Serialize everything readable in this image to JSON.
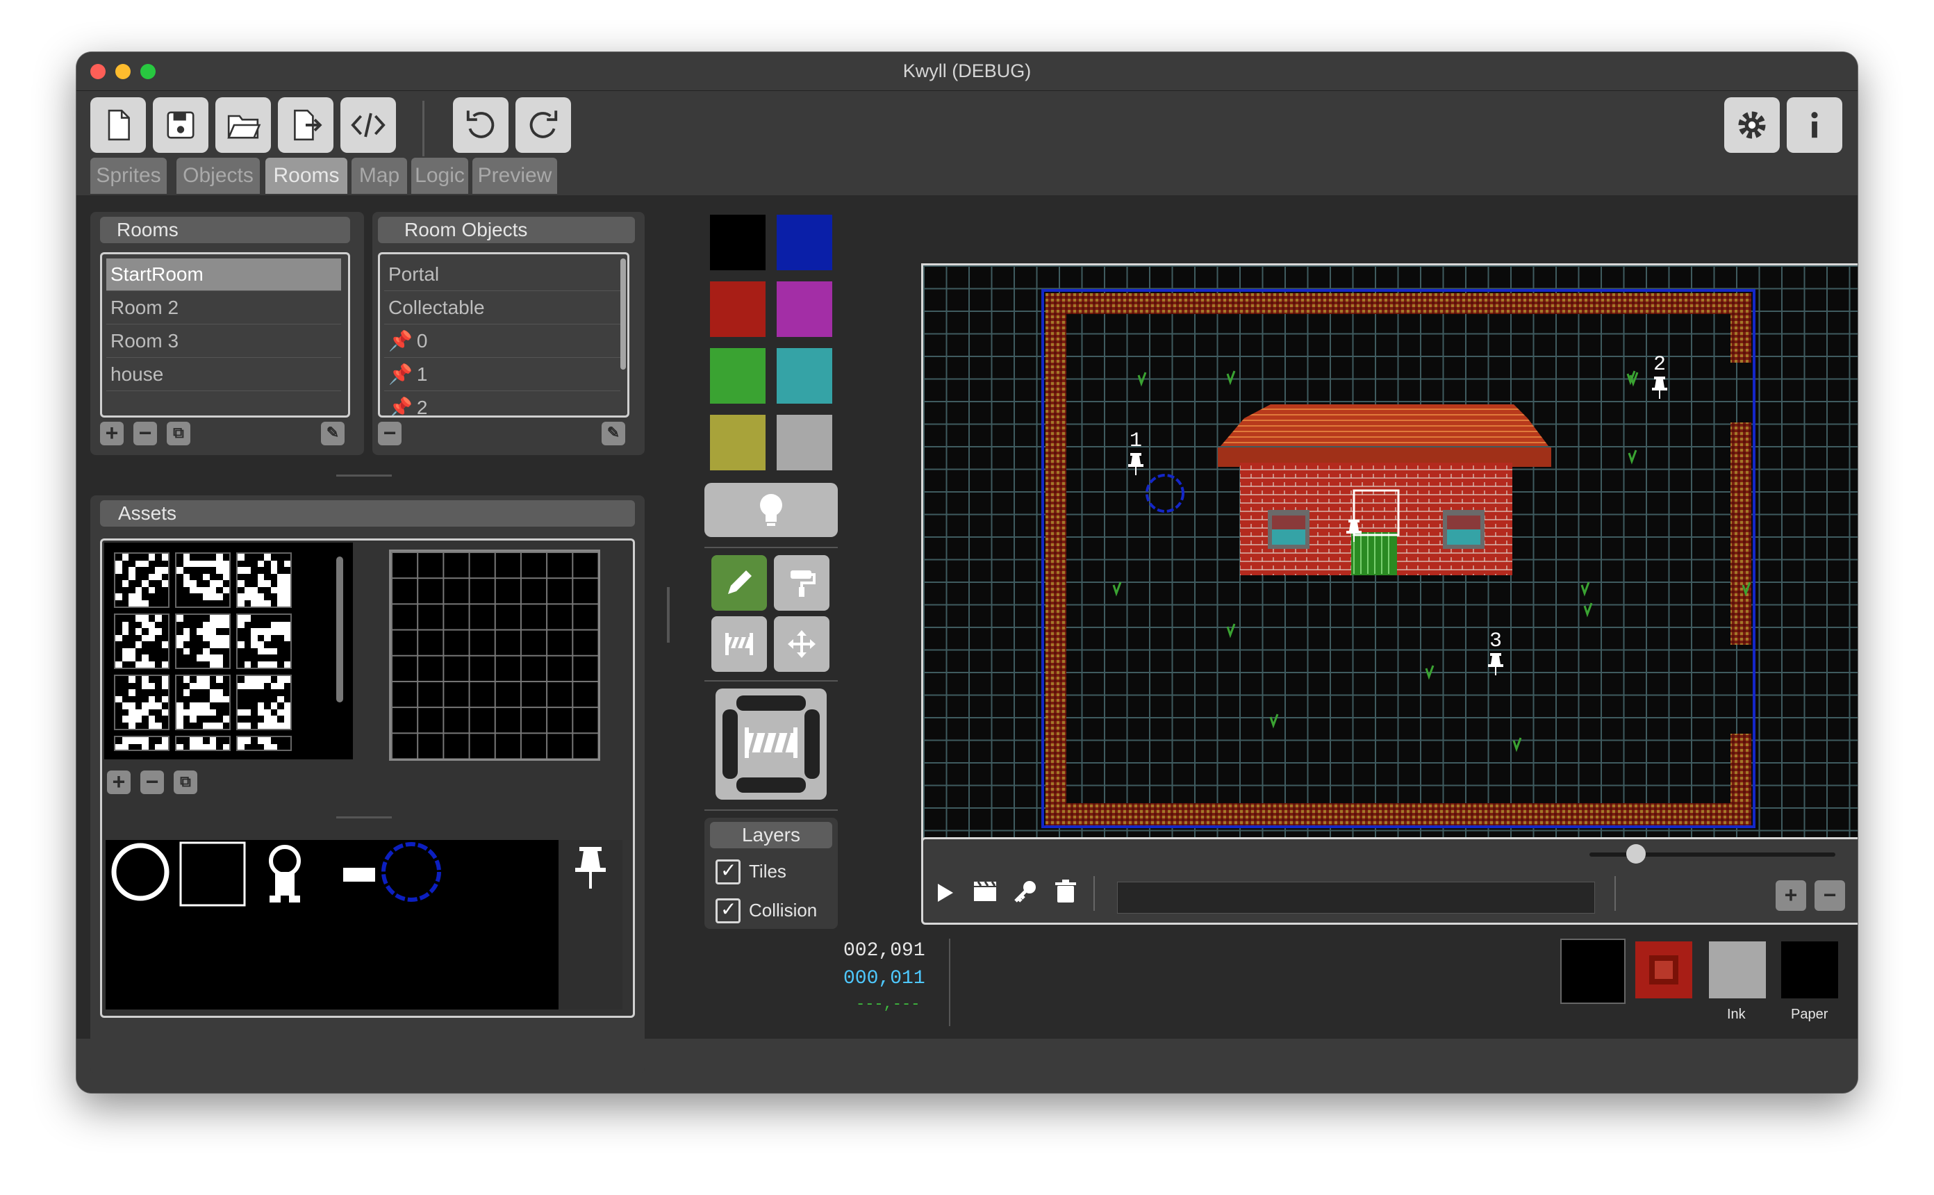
{
  "window": {
    "title": "Kwyll (DEBUG)"
  },
  "tabs": [
    "Sprites",
    "Objects",
    "Rooms",
    "Map",
    "Logic",
    "Preview"
  ],
  "toolbar": {
    "icons": [
      "new-file-icon",
      "save-icon",
      "open-folder-icon",
      "export-icon",
      "code-icon",
      "undo-icon",
      "redo-icon",
      "settings-icon",
      "info-icon"
    ]
  },
  "rooms": {
    "header": "Rooms",
    "items": [
      "StartRoom",
      "Room 2",
      "Room 3",
      "house"
    ],
    "selected": "StartRoom"
  },
  "room_objects": {
    "header": "Room Objects",
    "items": [
      "Portal",
      "Collectable",
      "0",
      "1",
      "2"
    ]
  },
  "assets": {
    "header": "Assets"
  },
  "layers": {
    "header": "Layers",
    "tiles_label": "Tiles",
    "collision_label": "Collision",
    "tiles_checked": true,
    "collision_checked": true
  },
  "palette": {
    "colors": [
      "#000000",
      "#0a1fa8",
      "#a81e16",
      "#a32ea6",
      "#3aa332",
      "#35a3a6",
      "#a8a33a",
      "#a8a8a8"
    ]
  },
  "map": {
    "markers": [
      "1",
      "2",
      "3"
    ]
  },
  "coords": {
    "pos1": "002,091",
    "pos2": "000,011",
    "pos3": "---,---"
  },
  "ink_paper": {
    "ink_label": "Ink",
    "paper_label": "Paper",
    "ink_color": "#a8a8a8",
    "paper_color": "#000000"
  },
  "timeline": {
    "slider_fraction": 0.19
  }
}
